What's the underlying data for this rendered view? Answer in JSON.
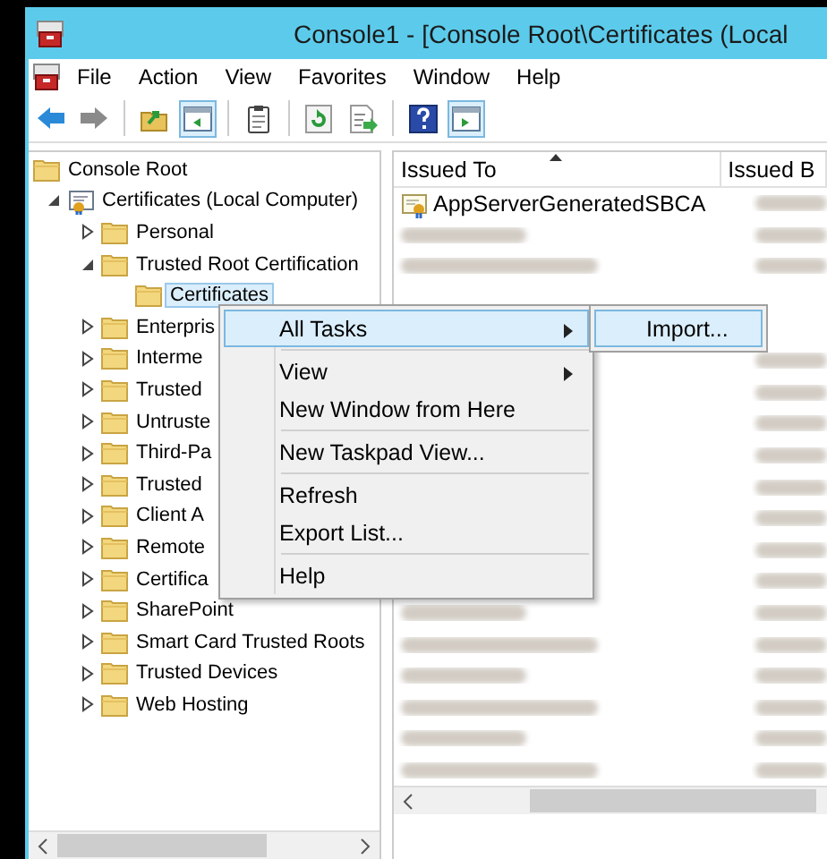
{
  "window": {
    "title": "Console1 - [Console Root\\Certificates (Local"
  },
  "menu_bar": [
    "File",
    "Action",
    "View",
    "Favorites",
    "Window",
    "Help"
  ],
  "toolbar": [
    {
      "kind": "back",
      "pressed": false
    },
    {
      "kind": "forward",
      "pressed": false
    },
    {
      "kind": "up",
      "pressed": false
    },
    {
      "kind": "tree",
      "pressed": true
    },
    {
      "kind": "clipboard",
      "pressed": false
    },
    {
      "kind": "refresh",
      "pressed": false
    },
    {
      "kind": "export",
      "pressed": false
    },
    {
      "kind": "help",
      "pressed": false
    },
    {
      "kind": "pane",
      "pressed": true
    }
  ],
  "tree": [
    {
      "label": "Console Root",
      "kind": "folder",
      "selected": false,
      "children": [
        {
          "label": "Certificates (Local Computer)",
          "kind": "snapin",
          "expanded": true,
          "selected": false,
          "children": [
            {
              "label": "Personal",
              "kind": "folder",
              "expanded": false,
              "selected": false
            },
            {
              "label": "Trusted Root Certification",
              "kind": "folder",
              "expanded": true,
              "selected": false,
              "children": [
                {
                  "label": "Certificates",
                  "kind": "folder",
                  "selected": true
                }
              ]
            },
            {
              "label": "Enterpris",
              "kind": "folder",
              "expanded": false,
              "selected": false
            },
            {
              "label": "Interme",
              "kind": "folder",
              "expanded": false,
              "selected": false
            },
            {
              "label": "Trusted",
              "kind": "folder",
              "expanded": false,
              "selected": false
            },
            {
              "label": "Untruste",
              "kind": "folder",
              "expanded": false,
              "selected": false
            },
            {
              "label": "Third-Pa",
              "kind": "folder",
              "expanded": false,
              "selected": false
            },
            {
              "label": "Trusted",
              "kind": "folder",
              "expanded": false,
              "selected": false
            },
            {
              "label": "Client A",
              "kind": "folder",
              "expanded": false,
              "selected": false
            },
            {
              "label": "Remote",
              "kind": "folder",
              "expanded": false,
              "selected": false
            },
            {
              "label": "Certifica",
              "kind": "folder",
              "expanded": false,
              "selected": false
            },
            {
              "label": "SharePoint",
              "kind": "folder",
              "expanded": false,
              "selected": false
            },
            {
              "label": "Smart Card Trusted Roots",
              "kind": "folder",
              "expanded": false,
              "selected": false
            },
            {
              "label": "Trusted Devices",
              "kind": "folder",
              "expanded": false,
              "selected": false
            },
            {
              "label": "Web Hosting",
              "kind": "folder",
              "expanded": false,
              "selected": false
            }
          ]
        }
      ]
    }
  ],
  "table": {
    "columns": [
      {
        "label": "Issued To",
        "sorted": true
      },
      {
        "label": "Issued B",
        "sorted": false
      }
    ],
    "rows": [
      {
        "kind": "cert",
        "issued_to": "AppServerGeneratedSBCA"
      },
      {
        "kind": "redacted"
      },
      {
        "kind": "redacted"
      },
      {
        "kind": "hidden"
      },
      {
        "kind": "hidden"
      },
      {
        "kind": "hidden"
      },
      {
        "kind": "hidden"
      },
      {
        "kind": "hidden"
      },
      {
        "kind": "hidden"
      },
      {
        "kind": "hidden"
      },
      {
        "kind": "hidden"
      },
      {
        "kind": "hidden"
      },
      {
        "kind": "hidden"
      },
      {
        "kind": "redacted"
      },
      {
        "kind": "redacted"
      },
      {
        "kind": "redacted"
      },
      {
        "kind": "redacted"
      },
      {
        "kind": "redacted"
      },
      {
        "kind": "redacted"
      }
    ]
  },
  "context_menu": {
    "items": [
      {
        "kind": "item",
        "label": "All Tasks",
        "submenu": true,
        "selected": true
      },
      {
        "kind": "separator"
      },
      {
        "kind": "item",
        "label": "View",
        "submenu": true,
        "selected": false
      },
      {
        "kind": "item",
        "label": "New Window from Here",
        "submenu": false,
        "selected": false
      },
      {
        "kind": "separator"
      },
      {
        "kind": "item",
        "label": "New Taskpad View...",
        "submenu": false,
        "selected": false
      },
      {
        "kind": "separator"
      },
      {
        "kind": "item",
        "label": "Refresh",
        "submenu": false,
        "selected": false
      },
      {
        "kind": "item",
        "label": "Export List...",
        "submenu": false,
        "selected": false
      },
      {
        "kind": "separator"
      },
      {
        "kind": "item",
        "label": "Help",
        "submenu": false,
        "selected": false
      }
    ],
    "submenu": [
      {
        "label": "Import...",
        "selected": true
      }
    ]
  }
}
